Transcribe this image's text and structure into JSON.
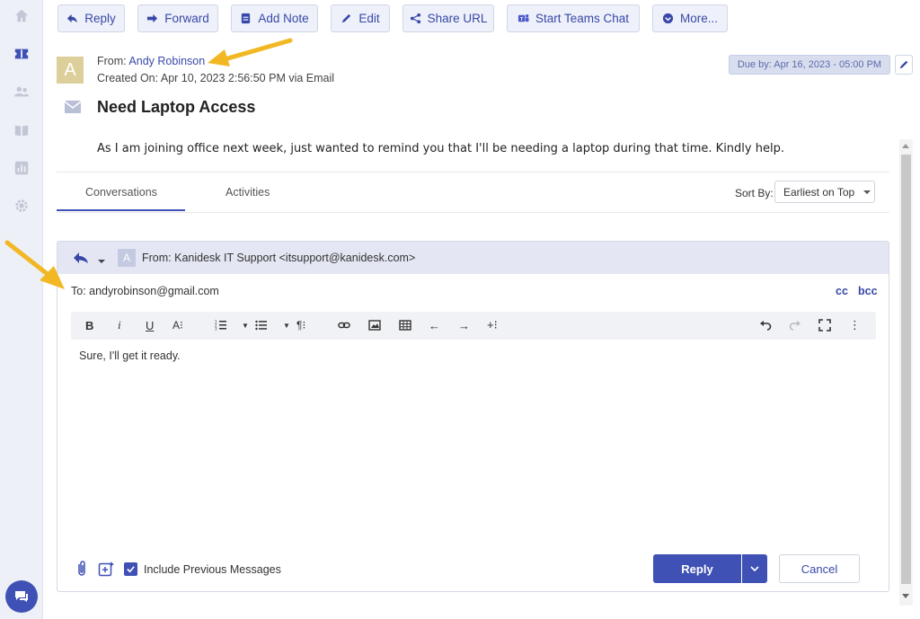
{
  "toolbar": {
    "reply": "Reply",
    "forward": "Forward",
    "add_note": "Add Note",
    "edit": "Edit",
    "share_url": "Share URL",
    "start_teams_chat": "Start Teams Chat",
    "more": "More..."
  },
  "sidebar": {
    "items": [
      "home-icon",
      "ticket-icon",
      "users-icon",
      "knowledge-base-icon",
      "reports-icon",
      "settings-icon"
    ],
    "chat_icon": "chat-icon"
  },
  "ticket": {
    "avatar_initial": "A",
    "from_label": "From: ",
    "from_name": "Andy Robinson",
    "created": "Created On: Apr 10, 2023 2:56:50 PM via Email",
    "due": "Due by: Apr 16, 2023 - 05:00 PM",
    "subject": "Need Laptop Access",
    "body": "As I am joining office next week, just wanted to remind you that I'll be needing a laptop during that time. Kindly help."
  },
  "tabs": [
    "Conversations",
    "Activities"
  ],
  "sort": {
    "label": "Sort By:",
    "value": "Earliest on Top"
  },
  "reply_panel": {
    "avatar_initial": "A",
    "from": "From: Kanidesk IT Support <itsupport@kanidesk.com>",
    "to": "To: andyrobinson@gmail.com",
    "cc": "cc",
    "bcc": "bcc",
    "editor_text": "Sure, I'll get it ready.",
    "include_previous": "Include Previous Messages",
    "include_previous_checked": true,
    "reply_button": "Reply",
    "cancel_button": "Cancel"
  },
  "colors": {
    "accent": "#3f51b5",
    "annotation_arrow": "#f2b824"
  }
}
